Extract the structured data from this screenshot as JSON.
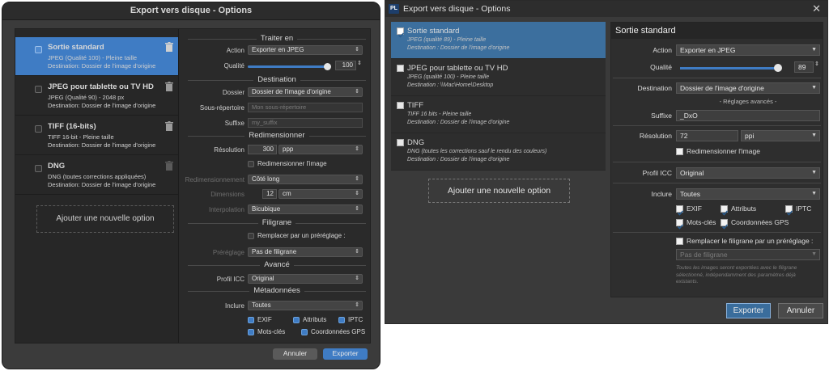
{
  "mac": {
    "title": "Export vers disque - Options",
    "items": [
      {
        "title": "Sortie standard",
        "line1": "JPEG (Qualité 100) - Pleine taille",
        "line2": "Destination: Dossier de l'image d'origine"
      },
      {
        "title": "JPEG pour tablette ou TV HD",
        "line1": "JPEG (Qualité 90) - 2048 px",
        "line2": "Destination: Dossier de l'image d'origine"
      },
      {
        "title": "TIFF (16-bits)",
        "line1": "TIFF 16-bit - Pleine taille",
        "line2": "Destination: Dossier de l'image d'origine"
      },
      {
        "title": "DNG",
        "line1": "DNG (toutes corrections appliquées)",
        "line2": "Destination: Dossier de l'image d'origine"
      }
    ],
    "add_label": "Ajouter une nouvelle option",
    "sections": {
      "traiter": "Traiter en",
      "destination": "Destination",
      "redim": "Redimensionner",
      "filigrane": "Filigrane",
      "avance": "Avancé",
      "meta": "Métadonnées"
    },
    "form": {
      "action_label": "Action",
      "action_value": "Exporter en JPEG",
      "qualite_label": "Qualité",
      "qualite_value": "100",
      "dossier_label": "Dossier",
      "dossier_value": "Dossier de l'image d'origine",
      "sousrep_label": "Sous-répertoire",
      "sousrep_placeholder": "Mon sous-répertoire",
      "suffixe_label": "Suffixe",
      "suffixe_placeholder": "my_suffix",
      "resolution_label": "Résolution",
      "resolution_value": "300",
      "resolution_unit": "ppp",
      "redim_check_label": "Redimensionner l'image",
      "redimmode_label": "Redimensionnement",
      "redimmode_value": "Côté long",
      "dimensions_label": "Dimensions",
      "dimensions_value": "12",
      "dimensions_unit": "cm",
      "interp_label": "Interpolation",
      "interp_value": "Bicubique",
      "filigrane_check_label": "Remplacer par un préréglage :",
      "preglage_label": "Préréglage",
      "preglage_value": "Pas de filigrane",
      "icc_label": "Profil ICC",
      "icc_value": "Original",
      "inclure_label": "Inclure",
      "inclure_value": "Toutes",
      "exif": "EXIF",
      "attributs": "Attributs",
      "iptc": "IPTC",
      "motscles": "Mots-clés",
      "coord": "Coordonnées GPS"
    },
    "cancel": "Annuler",
    "export": "Exporter"
  },
  "win": {
    "title": "Export vers disque - Options",
    "logo": "PL",
    "items": [
      {
        "title": "Sortie standard",
        "line1": "JPEG (qualité 89) - Pleine taille",
        "line2": "Destination : Dossier de l'image d'origine"
      },
      {
        "title": "JPEG pour tablette ou TV HD",
        "line1": "JPEG (qualité 100) - Pleine taille",
        "line2": "Destination : \\\\Mac\\Home\\Desktop"
      },
      {
        "title": "TIFF",
        "line1": "TIFF 16 bits - Pleine taille",
        "line2": "Destination : Dossier de l'image d'origine"
      },
      {
        "title": "DNG",
        "line1": "DNG (toutes les corrections sauf le rendu des couleurs)",
        "line2": "Destination : Dossier de l'image d'origine"
      }
    ],
    "add_label": "Ajouter une nouvelle option",
    "panel_title": "Sortie standard",
    "form": {
      "action_label": "Action",
      "action_value": "Exporter en JPEG",
      "qualite_label": "Qualité",
      "qualite_value": "89",
      "destination_label": "Destination",
      "destination_value": "Dossier de l'image d'origine",
      "reglages": "- Réglages avancés -",
      "suffixe_label": "Suffixe",
      "suffixe_value": "_DxO",
      "resolution_label": "Résolution",
      "resolution_value": "72",
      "resolution_unit": "ppi",
      "redim_label": "Redimensionner l'image",
      "icc_label": "Profil ICC",
      "icc_value": "Original",
      "inclure_label": "Inclure",
      "inclure_value": "Toutes",
      "exif": "EXIF",
      "attributs": "Attributs",
      "iptc": "IPTC",
      "motscles": "Mots-clés",
      "coord": "Coordonnées GPS",
      "filigrane_label": "Remplacer le filigrane par un préréglage :",
      "filigrane_value": "Pas de filigrane",
      "note": "Toutes les images seront exportées avec le filigrane sélectionné, indépendamment des paramètres déjà existants."
    },
    "export": "Exporter",
    "cancel": "Annuler"
  }
}
